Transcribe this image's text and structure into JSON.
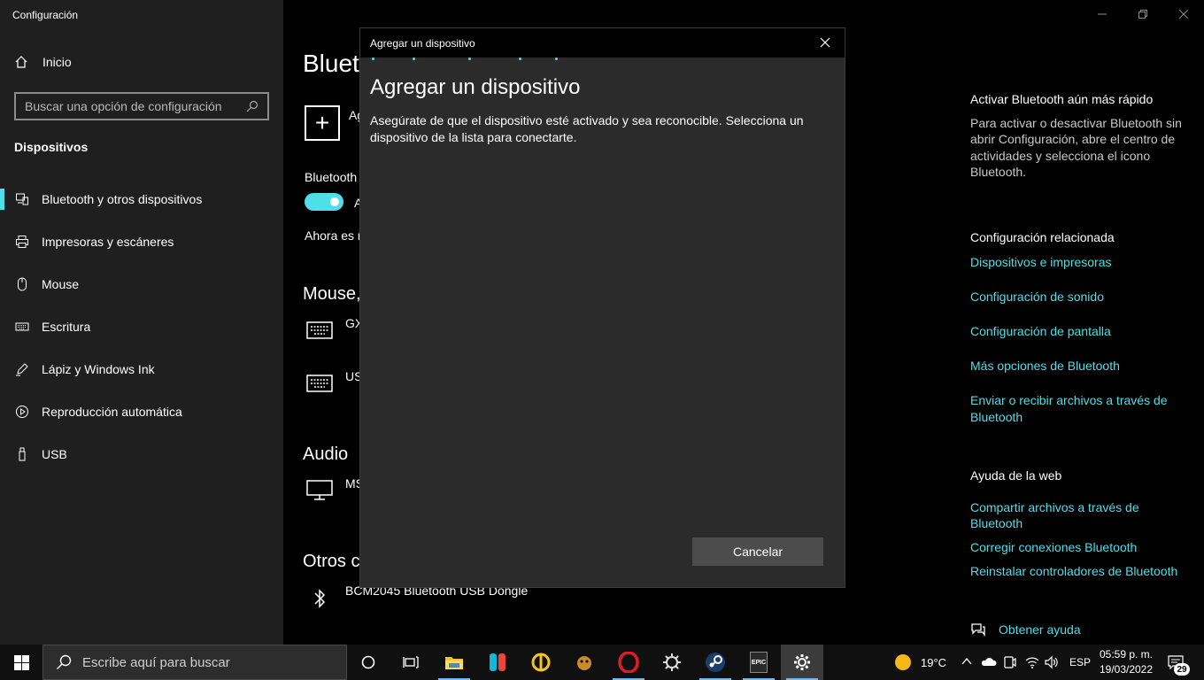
{
  "window": {
    "title": "Configuración"
  },
  "sidebar": {
    "home_label": "Inicio",
    "search_placeholder": "Buscar una opción de configuración",
    "section": "Dispositivos",
    "items": [
      {
        "label": "Bluetooth y otros dispositivos",
        "icon": "bluetooth-devices-icon",
        "active": true
      },
      {
        "label": "Impresoras y escáneres",
        "icon": "printer-icon",
        "active": false
      },
      {
        "label": "Mouse",
        "icon": "mouse-icon",
        "active": false
      },
      {
        "label": "Escritura",
        "icon": "keyboard-icon",
        "active": false
      },
      {
        "label": "Lápiz y Windows Ink",
        "icon": "pen-icon",
        "active": false
      },
      {
        "label": "Reproducción automática",
        "icon": "autoplay-icon",
        "active": false
      },
      {
        "label": "USB",
        "icon": "usb-icon",
        "active": false
      }
    ]
  },
  "main": {
    "title": "Blueto",
    "add_label": "Ag",
    "bluetooth_label": "Bluetooth",
    "toggle_state_text": "A",
    "now_text": "Ahora es r",
    "sections": {
      "mouse": "Mouse,",
      "audio": "Audio",
      "other": "Otros c"
    },
    "devices": {
      "mouse1": "GX",
      "mouse2": "US",
      "audio1": "MS",
      "other1": "BCM2045 Bluetooth USB Dongle"
    }
  },
  "right_pane": {
    "quick_heading": "Activar Bluetooth aún más rápido",
    "quick_text": "Para activar o desactivar Bluetooth sin abrir Configuración, abre el centro de actividades y selecciona el icono Bluetooth.",
    "related_heading": "Configuración relacionada",
    "related_links": [
      "Dispositivos e impresoras",
      "Configuración de sonido",
      "Configuración de pantalla",
      "Más opciones de Bluetooth",
      "Enviar o recibir archivos a través de Bluetooth"
    ],
    "web_heading": "Ayuda de la web",
    "web_links": [
      "Compartir archivos a través de Bluetooth",
      "Corregir conexiones Bluetooth",
      "Reinstalar controladores de Bluetooth"
    ],
    "help_link": "Obtener ayuda"
  },
  "dialog": {
    "window_title": "Agregar un dispositivo",
    "heading": "Agregar un dispositivo",
    "description": "Asegúrate de que el dispositivo esté activado y sea reconocible. Selecciona un dispositivo de la lista para conectarte.",
    "cancel_label": "Cancelar"
  },
  "taskbar": {
    "search_placeholder": "Escribe aquí para buscar",
    "weather": "19°C",
    "language": "ESP",
    "time": "05:59 p. m.",
    "date": "19/03/2022",
    "notifications": "29",
    "epic_label": "EPIC"
  },
  "colors": {
    "accent": "#4fdfe8",
    "sidebar_bg": "#1f1f1f",
    "dialog_bg": "#2b2b2b"
  }
}
